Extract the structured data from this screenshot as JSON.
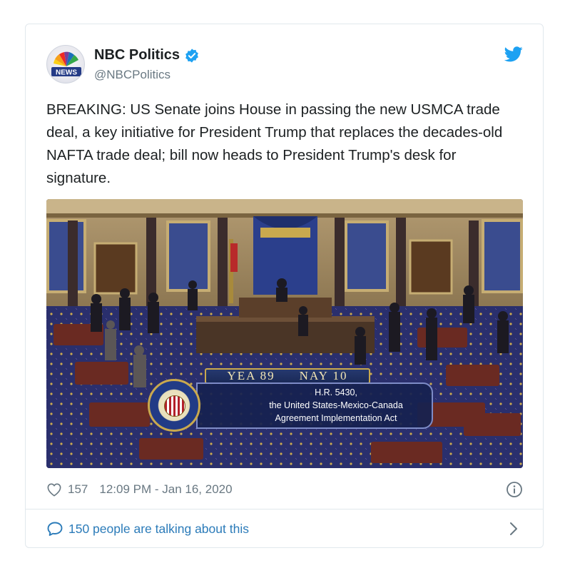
{
  "author": {
    "display_name": "NBC Politics",
    "handle": "@NBCPolitics",
    "avatar_text": "NEWS",
    "verified": true
  },
  "tweet": {
    "text": "BREAKING: US Senate joins House in passing the new USMCA trade deal, a key initiative for President Trump that replaces the decades-old NAFTA trade deal; bill now heads to President Trump's desk for signature."
  },
  "media": {
    "vote_yea": "YEA 89",
    "vote_nay": "NAY 10",
    "bill_number": "H.R. 5430,",
    "bill_title_line1": "the United States-Mexico-Canada",
    "bill_title_line2": "Agreement Implementation Act"
  },
  "footer": {
    "likes": "157",
    "timestamp": "12:09 PM - Jan 16, 2020",
    "talking": "150 people are talking about this"
  },
  "icons": {
    "heart": "heart-icon",
    "info": "info-icon",
    "comment": "speech-bubble-icon",
    "chevron": "chevron-right-icon",
    "twitter": "twitter-bird-icon",
    "verified": "verified-badge-icon"
  },
  "colors": {
    "link": "#2b7bb9",
    "verified": "#1da1f2",
    "muted": "#697882",
    "border": "#e1e8ed"
  }
}
